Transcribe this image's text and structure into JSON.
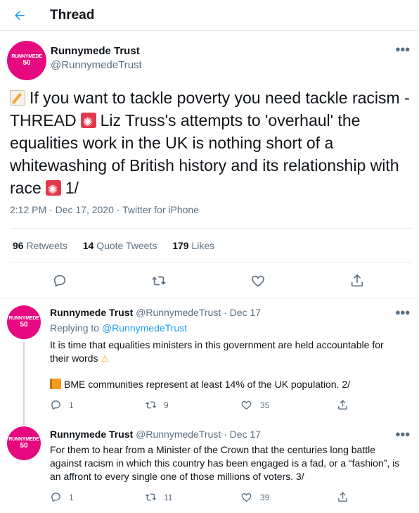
{
  "header": {
    "title": "Thread"
  },
  "colors": {
    "accent": "#1da1f2",
    "avatar_bg": "#e5087e",
    "muted": "#5b7083"
  },
  "avatar": {
    "line1": "RUNNYMEDE",
    "line2": "50"
  },
  "main_tweet": {
    "name": "Runnymede Trust",
    "handle": "@RunnymedeTrust",
    "text_1": "If you want to tackle poverty you need tackle racism - THREAD",
    "text_2": "Liz Truss's attempts to 'overhaul' the equalities work in the UK is nothing short of a whitewashing of British history and its relationship with race",
    "text_3": "1/",
    "emoji_names": [
      "memo-emoji",
      "rotating-light-emoji",
      "rotating-light-emoji"
    ],
    "time": "2:12 PM · Dec 17, 2020 · Twitter for iPhone",
    "stats": {
      "retweets_count": "96",
      "retweets_label": "Retweets",
      "quotes_count": "14",
      "quotes_label": "Quote Tweets",
      "likes_count": "179",
      "likes_label": "Likes"
    },
    "action_icons": [
      "reply-icon",
      "retweet-icon",
      "like-icon",
      "share-icon"
    ]
  },
  "replies": [
    {
      "name": "Runnymede Trust",
      "handle": "@RunnymedeTrust",
      "sep": "·",
      "date": "Dec 17",
      "replying_prefix": "Replying to",
      "replying_to": "@RunnymedeTrust",
      "text_1": "It is time that equalities ministers in this government are held accountable for their words",
      "text_2": "BME communities represent at least 14% of the UK population. 2/",
      "emoji_names": [
        "warning-emoji",
        "orange-book-emoji"
      ],
      "reply_count": "1",
      "retweet_count": "9",
      "like_count": "35"
    },
    {
      "name": "Runnymede Trust",
      "handle": "@RunnymedeTrust",
      "sep": "·",
      "date": "Dec 17",
      "text_1": "For them to hear from a Minister of the Crown that the centuries long battle against racism in which this country has been engaged is a fad, or a “fashion”, is an affront to every single one of those millions of voters. 3/",
      "reply_count": "1",
      "retweet_count": "11",
      "like_count": "39"
    }
  ]
}
